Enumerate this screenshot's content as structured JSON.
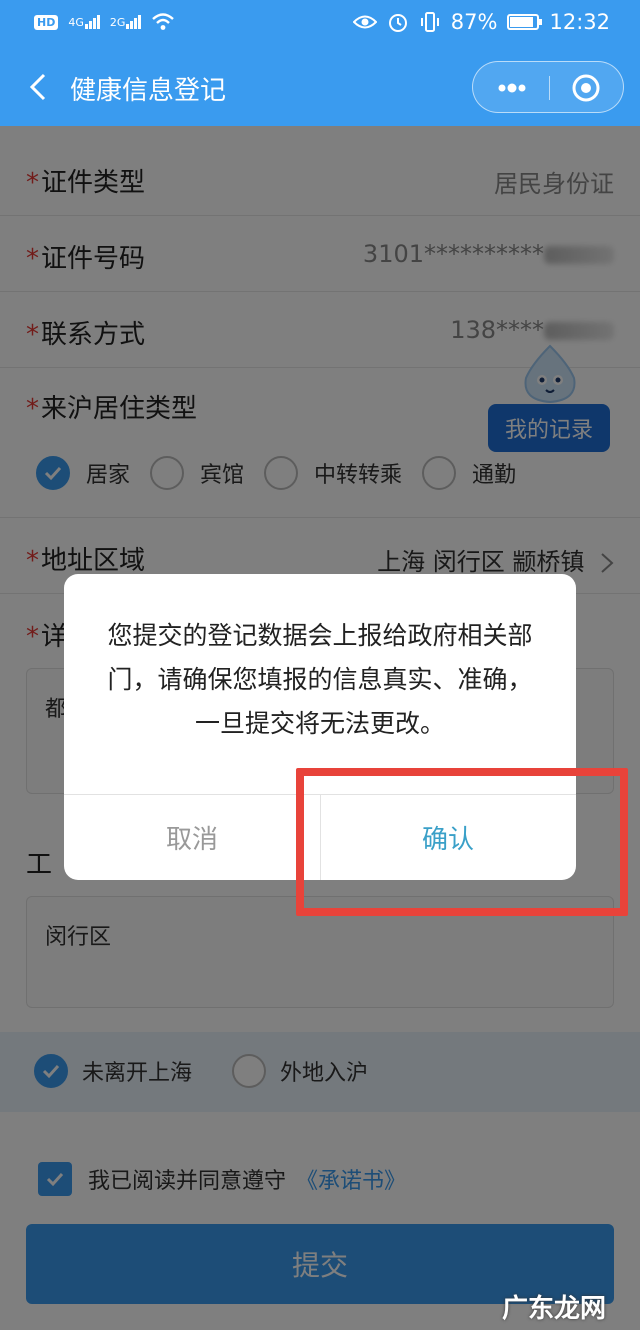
{
  "status_bar": {
    "hd": "HD",
    "net1": "4G",
    "net2": "2G",
    "battery_pct": "87%",
    "battery_level": 0.87,
    "time": "12:32"
  },
  "nav": {
    "title": "健康信息登记"
  },
  "form": {
    "id_type": {
      "label": "证件类型",
      "value": "居民身份证"
    },
    "id_number": {
      "label": "证件号码",
      "value": "3101**********"
    },
    "contact": {
      "label": "联系方式",
      "value": "138****"
    },
    "residence_type": {
      "label": "来沪居住类型",
      "options": [
        "居家",
        "宾馆",
        "中转转乘",
        "通勤"
      ],
      "selected": "居家"
    },
    "address_region": {
      "label": "地址区域",
      "value": "上海 闵行区 颛桥镇"
    },
    "detail_address": {
      "label": "详",
      "value": "都"
    },
    "work": {
      "label": "工",
      "value": "闵行区"
    },
    "location_options": [
      "未离开上海",
      "外地入沪"
    ],
    "location_selected": "未离开上海"
  },
  "mascot": {
    "label": "我的记录"
  },
  "agreement": {
    "text": "我已阅读并同意遵守",
    "link": "《承诺书》"
  },
  "submit_label": "提交",
  "dialog": {
    "message": "您提交的登记数据会上报给政府相关部门，请确保您填报的信息真实、准确，一旦提交将无法更改。",
    "cancel": "取消",
    "confirm": "确认"
  },
  "watermark": "广东龙网",
  "colors": {
    "brand": "#3a9bef",
    "required": "#e53935",
    "highlight": "#e8433a",
    "confirm": "#3aa0c8"
  }
}
